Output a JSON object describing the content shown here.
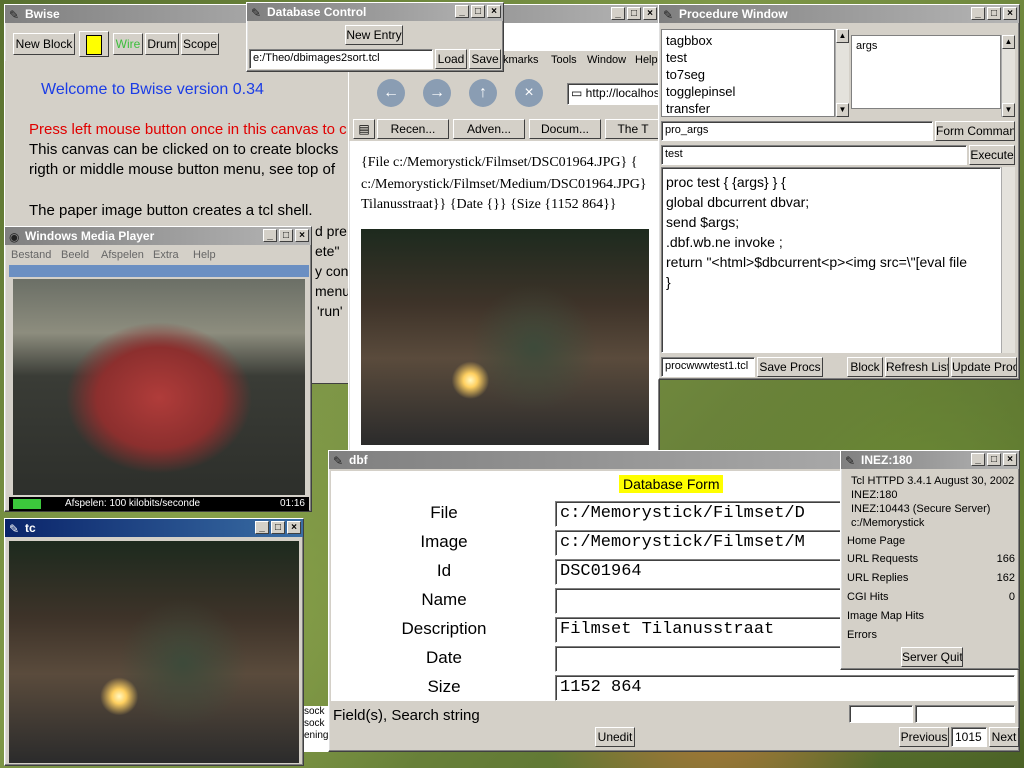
{
  "bwise": {
    "title": "Bwise",
    "buttons": {
      "new_block": "New Block",
      "wire": "Wire",
      "drum": "Drum",
      "scope": "Scope"
    },
    "welcome": "Welcome to Bwise version 0.34",
    "line_red": "Press left mouse button once in this canvas to c",
    "line1": "This canvas can be clicked on to create blocks",
    "line2": "rigth or middle mouse button menu, see top of",
    "line3": "The paper image button creates a tcl shell.",
    "frag1": "d pre",
    "frag2": "ete\"",
    "frag3": "y con",
    "frag4": "menu.",
    "frag5": "'run'"
  },
  "db_control": {
    "title": "Database Control",
    "new_entry": "New Entry",
    "path": "e:/Theo/dbimages2sort.tcl",
    "load": "Load",
    "save": "Save"
  },
  "browser": {
    "menu": [
      "kmarks",
      "Tools",
      "Window",
      "Help"
    ],
    "url": "http://localhos",
    "tabs": [
      "Recen...",
      "Adven...",
      "Docum...",
      "The T"
    ],
    "content_lines": [
      "{File c:/Memorystick/Filmset/DSC01964.JPG} {",
      "c:/Memorystick/Filmset/Medium/DSC01964.JPG}",
      "Tilanusstraat}} {Date {}} {Size {1152 864}}"
    ]
  },
  "procedure": {
    "title": "Procedure Window",
    "list": [
      "tagbbox",
      "test",
      "to7seg",
      "togglepinsel",
      "transfer"
    ],
    "args_box": "args",
    "args_field": "pro_args",
    "form_command": "Form Command",
    "exec_field": "test",
    "execute": "Execute",
    "code": [
      "proc test { {args} } {",
      "global dbcurrent dbvar;",
      "send $args;",
      ".dbf.wb.ne invoke ;",
      "return \"<html>$dbcurrent<p><img src=\\\"[eval file",
      "}"
    ],
    "file_field": "procwwwtest1.tcl",
    "save_procs": "Save Procs",
    "block": "Block",
    "refresh_list": "Refresh List",
    "update_proc": "Update Proc"
  },
  "wmp": {
    "title": "Windows Media Player",
    "menu": [
      "Bestand",
      "Beeld",
      "Afspelen",
      "Extra",
      "Help"
    ],
    "status": "Afspelen: 100 kilobits/seconde",
    "time": "01:16"
  },
  "tc": {
    "title": "tc",
    "fragments": [
      "sock",
      "sock",
      "ening"
    ]
  },
  "dbf": {
    "title": "dbf",
    "heading": "Database Form",
    "fields": [
      {
        "label": "File",
        "value": "c:/Memorystick/Filmset/D"
      },
      {
        "label": "Image",
        "value": "c:/Memorystick/Filmset/M"
      },
      {
        "label": "Id",
        "value": "DSC01964"
      },
      {
        "label": "Name",
        "value": ""
      },
      {
        "label": "Description",
        "value": "Filmset Tilanusstraat"
      },
      {
        "label": "Date",
        "value": ""
      },
      {
        "label": "Size",
        "value": "1152 864"
      }
    ],
    "search_label": "Field(s), Search string",
    "unedit": "Unedit",
    "previous": "Previous",
    "record": "1015",
    "next": "Next"
  },
  "inez": {
    "title": "INEZ:180",
    "info": [
      "Tcl HTTPD 3.4.1 August 30, 2002",
      "INEZ:180",
      "INEZ:10443 (Secure Server)",
      "c:/Memorystick"
    ],
    "home_page": "Home Page",
    "stats": [
      {
        "label": "URL Requests",
        "value": "166"
      },
      {
        "label": "URL Replies",
        "value": "162"
      },
      {
        "label": "CGI Hits",
        "value": "0"
      },
      {
        "label": "Image Map Hits",
        "value": ""
      },
      {
        "label": "Errors",
        "value": ""
      }
    ],
    "server_quit": "Server Quit"
  }
}
